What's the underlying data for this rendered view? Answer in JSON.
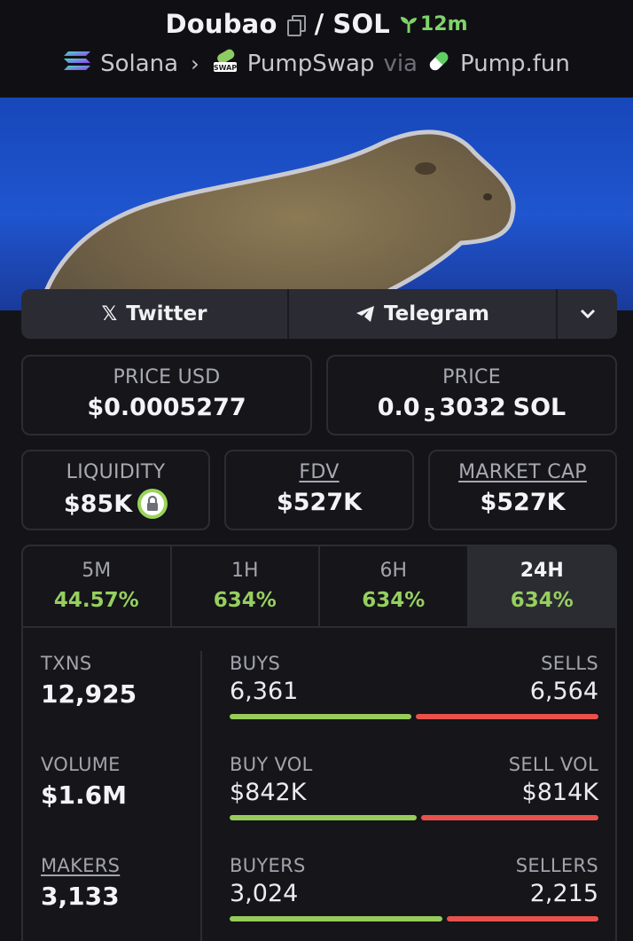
{
  "header": {
    "token": "Doubao",
    "separator": "/",
    "quote": "SOL",
    "age": "12m",
    "chain": "Solana",
    "dex": "PumpSwap",
    "via": "via",
    "launchpad": "Pump.fun"
  },
  "social": {
    "twitter": "Twitter",
    "telegram": "Telegram"
  },
  "price_usd": {
    "label": "PRICE USD",
    "value": "$0.0005277"
  },
  "price_native": {
    "label": "PRICE",
    "prefix": "0.0",
    "zeros": "5",
    "digits": "3032",
    "unit": "SOL"
  },
  "liquidity": {
    "label": "LIQUIDITY",
    "value": "$85K"
  },
  "fdv": {
    "label": "FDV",
    "value": "$527K"
  },
  "market_cap": {
    "label": "MARKET CAP",
    "value": "$527K"
  },
  "tabs": [
    {
      "label": "5M",
      "value": "44.57%"
    },
    {
      "label": "1H",
      "value": "634%"
    },
    {
      "label": "6H",
      "value": "634%"
    },
    {
      "label": "24H",
      "value": "634%"
    }
  ],
  "active_tab": "24H",
  "txns": {
    "label": "TXNS",
    "value": "12,925"
  },
  "volume": {
    "label": "VOLUME",
    "value": "$1.6M"
  },
  "makers": {
    "label": "MAKERS",
    "value": "3,133"
  },
  "buys_sells": {
    "left_label": "BUYS",
    "right_label": "SELLS",
    "left": "6,361",
    "right": "6,564",
    "buy_fraction": 0.492
  },
  "vol_split": {
    "left_label": "BUY VOL",
    "right_label": "SELL VOL",
    "left": "$842K",
    "right": "$814K",
    "buy_fraction": 0.508
  },
  "buyers_sellers": {
    "left_label": "BUYERS",
    "right_label": "SELLERS",
    "left": "3,024",
    "right": "2,215",
    "buy_fraction": 0.577
  },
  "colors": {
    "positive": "#96cf5f",
    "negative": "#e8514c",
    "banner": "#1f55cf"
  }
}
